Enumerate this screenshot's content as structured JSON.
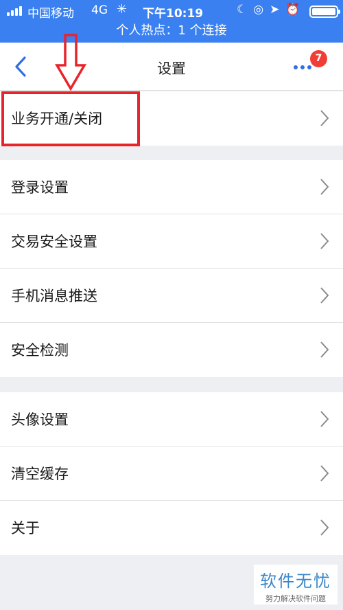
{
  "status_bar": {
    "carrier": "中国移动",
    "network": "4G",
    "time": "下午10:19"
  },
  "hotspot_bar": {
    "text": "个人热点：1 个连接"
  },
  "navbar": {
    "title": "设置",
    "badge_count": "7"
  },
  "groups": [
    {
      "items": [
        {
          "label": "业务开通/关闭"
        }
      ]
    },
    {
      "items": [
        {
          "label": "登录设置"
        },
        {
          "label": "交易安全设置"
        },
        {
          "label": "手机消息推送"
        },
        {
          "label": "安全检测"
        }
      ]
    },
    {
      "items": [
        {
          "label": "头像设置"
        },
        {
          "label": "清空缓存"
        },
        {
          "label": "关于"
        }
      ]
    }
  ],
  "watermark": {
    "title": "软件无忧",
    "subtitle": "努力解决软件问题"
  },
  "colors": {
    "status_bar_bg": "#3a80f0",
    "accent": "#2f6fe0",
    "badge": "#f03e36",
    "annotation": "#e8242a"
  }
}
